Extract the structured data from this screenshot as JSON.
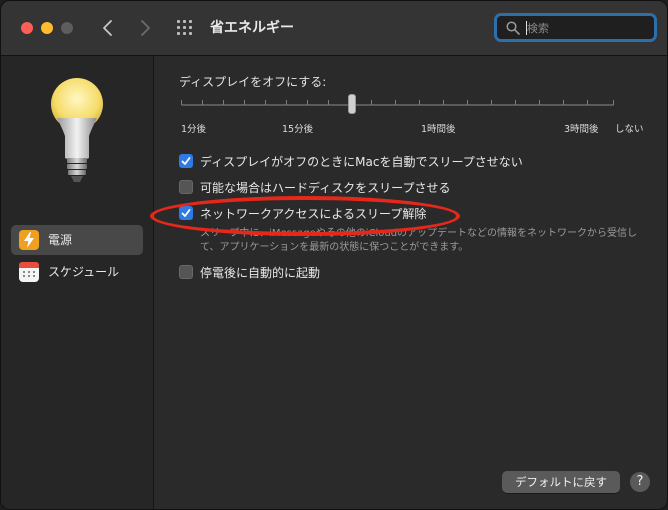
{
  "window": {
    "title": "省エネルギー"
  },
  "toolbar": {
    "back_icon": "chevron-left-icon",
    "forward_icon": "chevron-right-icon",
    "grid_icon": "grid-icon"
  },
  "search": {
    "placeholder": "検索",
    "value": ""
  },
  "sidebar": {
    "items": [
      {
        "label": "電源",
        "icon": "lightning-icon",
        "selected": true,
        "icon_color": "#f0a020"
      },
      {
        "label": "スケジュール",
        "icon": "calendar-icon",
        "selected": false,
        "icon_color": "#e74c3c"
      }
    ]
  },
  "display_sleep": {
    "label": "ディスプレイをオフにする:",
    "ticks": [
      "1分後",
      "15分後",
      "1時間後",
      "3時間後",
      "しない"
    ],
    "slider_value": "15分後"
  },
  "options": [
    {
      "label": "ディスプレイがオフのときにMacを自動でスリープさせない",
      "checked": true
    },
    {
      "label": "可能な場合はハードディスクをスリープさせる",
      "checked": false
    },
    {
      "label": "ネットワークアクセスによるスリープ解除",
      "checked": true,
      "description": "スリープ中に、iMessageやその他のiCloudのアップデートなどの情報をネットワークから受信して、アプリケーションを最新の状態に保つことができます。"
    },
    {
      "label": "停電後に自動的に起動",
      "checked": false
    }
  ],
  "footer": {
    "restore_defaults_label": "デフォルトに戻す",
    "help_label": "?"
  },
  "colors": {
    "accent": "#2f7ae5",
    "annotation": "#e8271b"
  }
}
